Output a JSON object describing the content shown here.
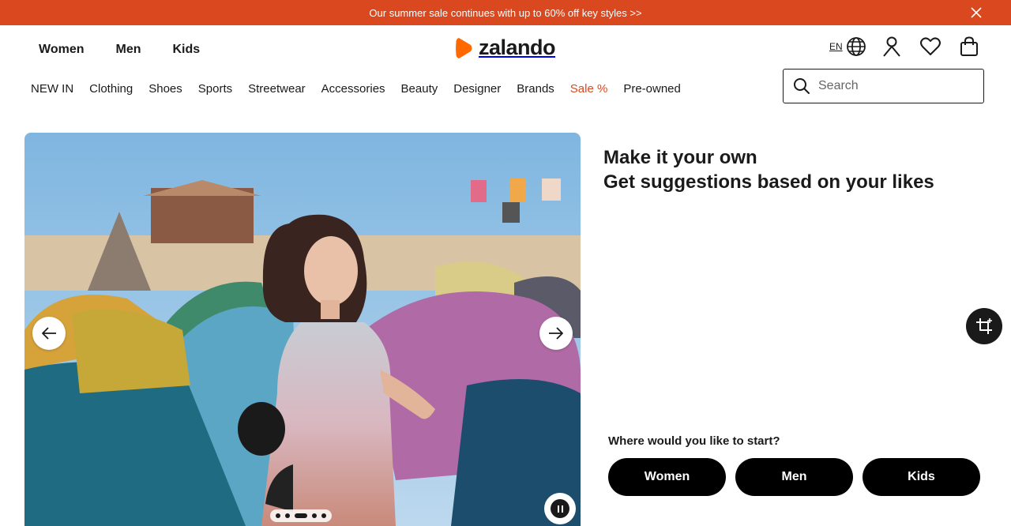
{
  "promo": {
    "text": "Our summer sale continues with up to 60% off key styles >>",
    "close_icon": "close-icon"
  },
  "gender_nav": [
    "Women",
    "Men",
    "Kids"
  ],
  "logo": {
    "text": "zalando",
    "brand_color": "#ff6900"
  },
  "header": {
    "language": "EN",
    "icons": [
      "globe-icon",
      "user-icon",
      "heart-icon",
      "bag-icon"
    ]
  },
  "categories": [
    {
      "label": "NEW IN"
    },
    {
      "label": "Clothing"
    },
    {
      "label": "Shoes"
    },
    {
      "label": "Sports"
    },
    {
      "label": "Streetwear"
    },
    {
      "label": "Accessories"
    },
    {
      "label": "Beauty"
    },
    {
      "label": "Designer"
    },
    {
      "label": "Brands"
    },
    {
      "label": "Sale %",
      "color": "#d9481f"
    },
    {
      "label": "Pre-owned"
    }
  ],
  "search": {
    "placeholder": "Search"
  },
  "hero": {
    "slide_count": 5,
    "active_slide": 3
  },
  "headline": {
    "line1": "Make it your own",
    "line2": "Get suggestions based on your likes"
  },
  "start": {
    "question": "Where would you like to start?",
    "buttons": [
      "Women",
      "Men",
      "Kids"
    ]
  },
  "colors": {
    "promo_bg": "#d9481f",
    "accent": "#ff6900",
    "sale": "#d9481f",
    "button_bg": "#000000"
  }
}
